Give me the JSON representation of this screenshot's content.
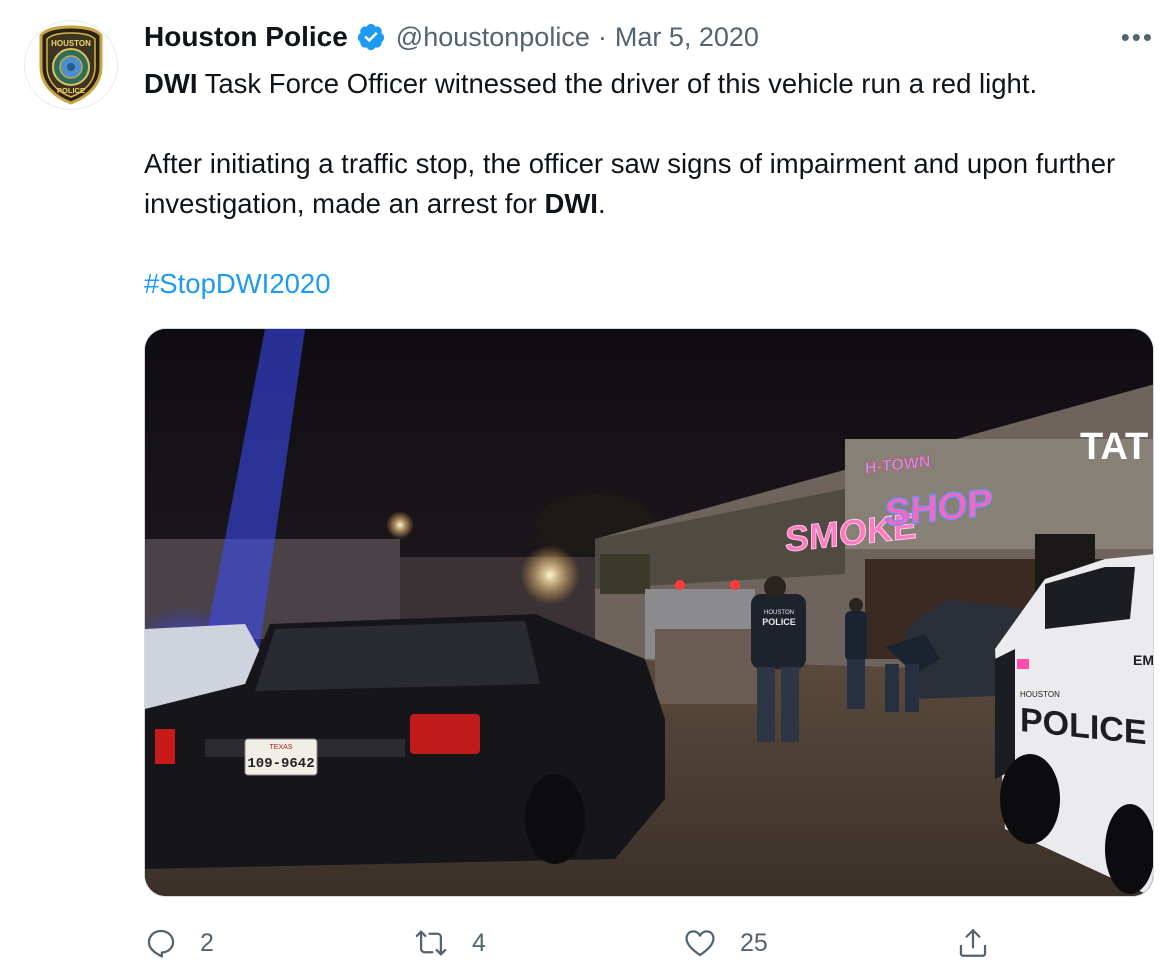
{
  "tweet": {
    "author": {
      "display_name": "Houston Police",
      "handle": "@houstonpolice",
      "verified": true,
      "avatar_icon": "houston-police-badge-icon"
    },
    "separator": "·",
    "date": "Mar 5, 2020",
    "more_label": "•••",
    "text": {
      "line1_bold": "DWI",
      "line1_rest": " Task Force Officer witnessed the driver of this vehicle run a red light.",
      "para2_a": "After initiating a traffic stop, the officer saw signs of impairment and upon further investigation, made an arrest for ",
      "para2_bold": "DWI",
      "para2_end": ".",
      "hashtag": "#StopDWI2020"
    },
    "media": {
      "sign_smoke": "SMOKE",
      "sign_shop": "SHOP",
      "sign_htown": "H-TOWN",
      "sign_tat": "TAT",
      "plate_state": "TEXAS",
      "plate_number": "109-9642",
      "vest_text": "POLICE",
      "vest_small": "HOUSTON",
      "car_text": "POLICE",
      "car_small": "HOUSTON",
      "car_side_text": "EME"
    },
    "actions": {
      "reply_count": "2",
      "retweet_count": "4",
      "like_count": "25"
    }
  },
  "colors": {
    "text_primary": "#0f1419",
    "text_secondary": "#536471",
    "hashtag": "#1d9bf0",
    "verified_badge": "#1d9bf0"
  }
}
